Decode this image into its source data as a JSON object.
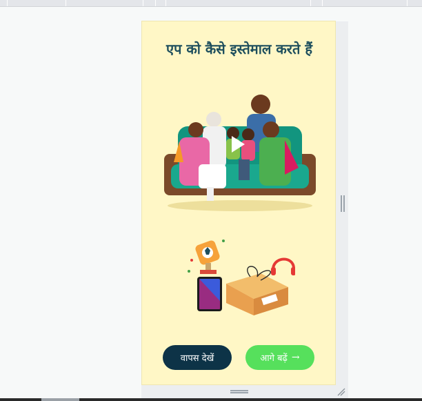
{
  "card": {
    "title": "एप को कैसे इस्तेमाल करते हैं",
    "back_button": "वापस देखें",
    "next_button": "आगे बढ़ें",
    "next_arrow": "→"
  },
  "icons": {
    "play": "play-icon",
    "resize_vertical": "resize-handle-icon",
    "resize_horizontal": "resize-handle-icon",
    "corner": "resize-corner-icon"
  },
  "colors": {
    "card_bg": "#fff7c6",
    "title": "#1d4e5d",
    "back_button": "#0d3347",
    "next_button": "#56e05c"
  }
}
